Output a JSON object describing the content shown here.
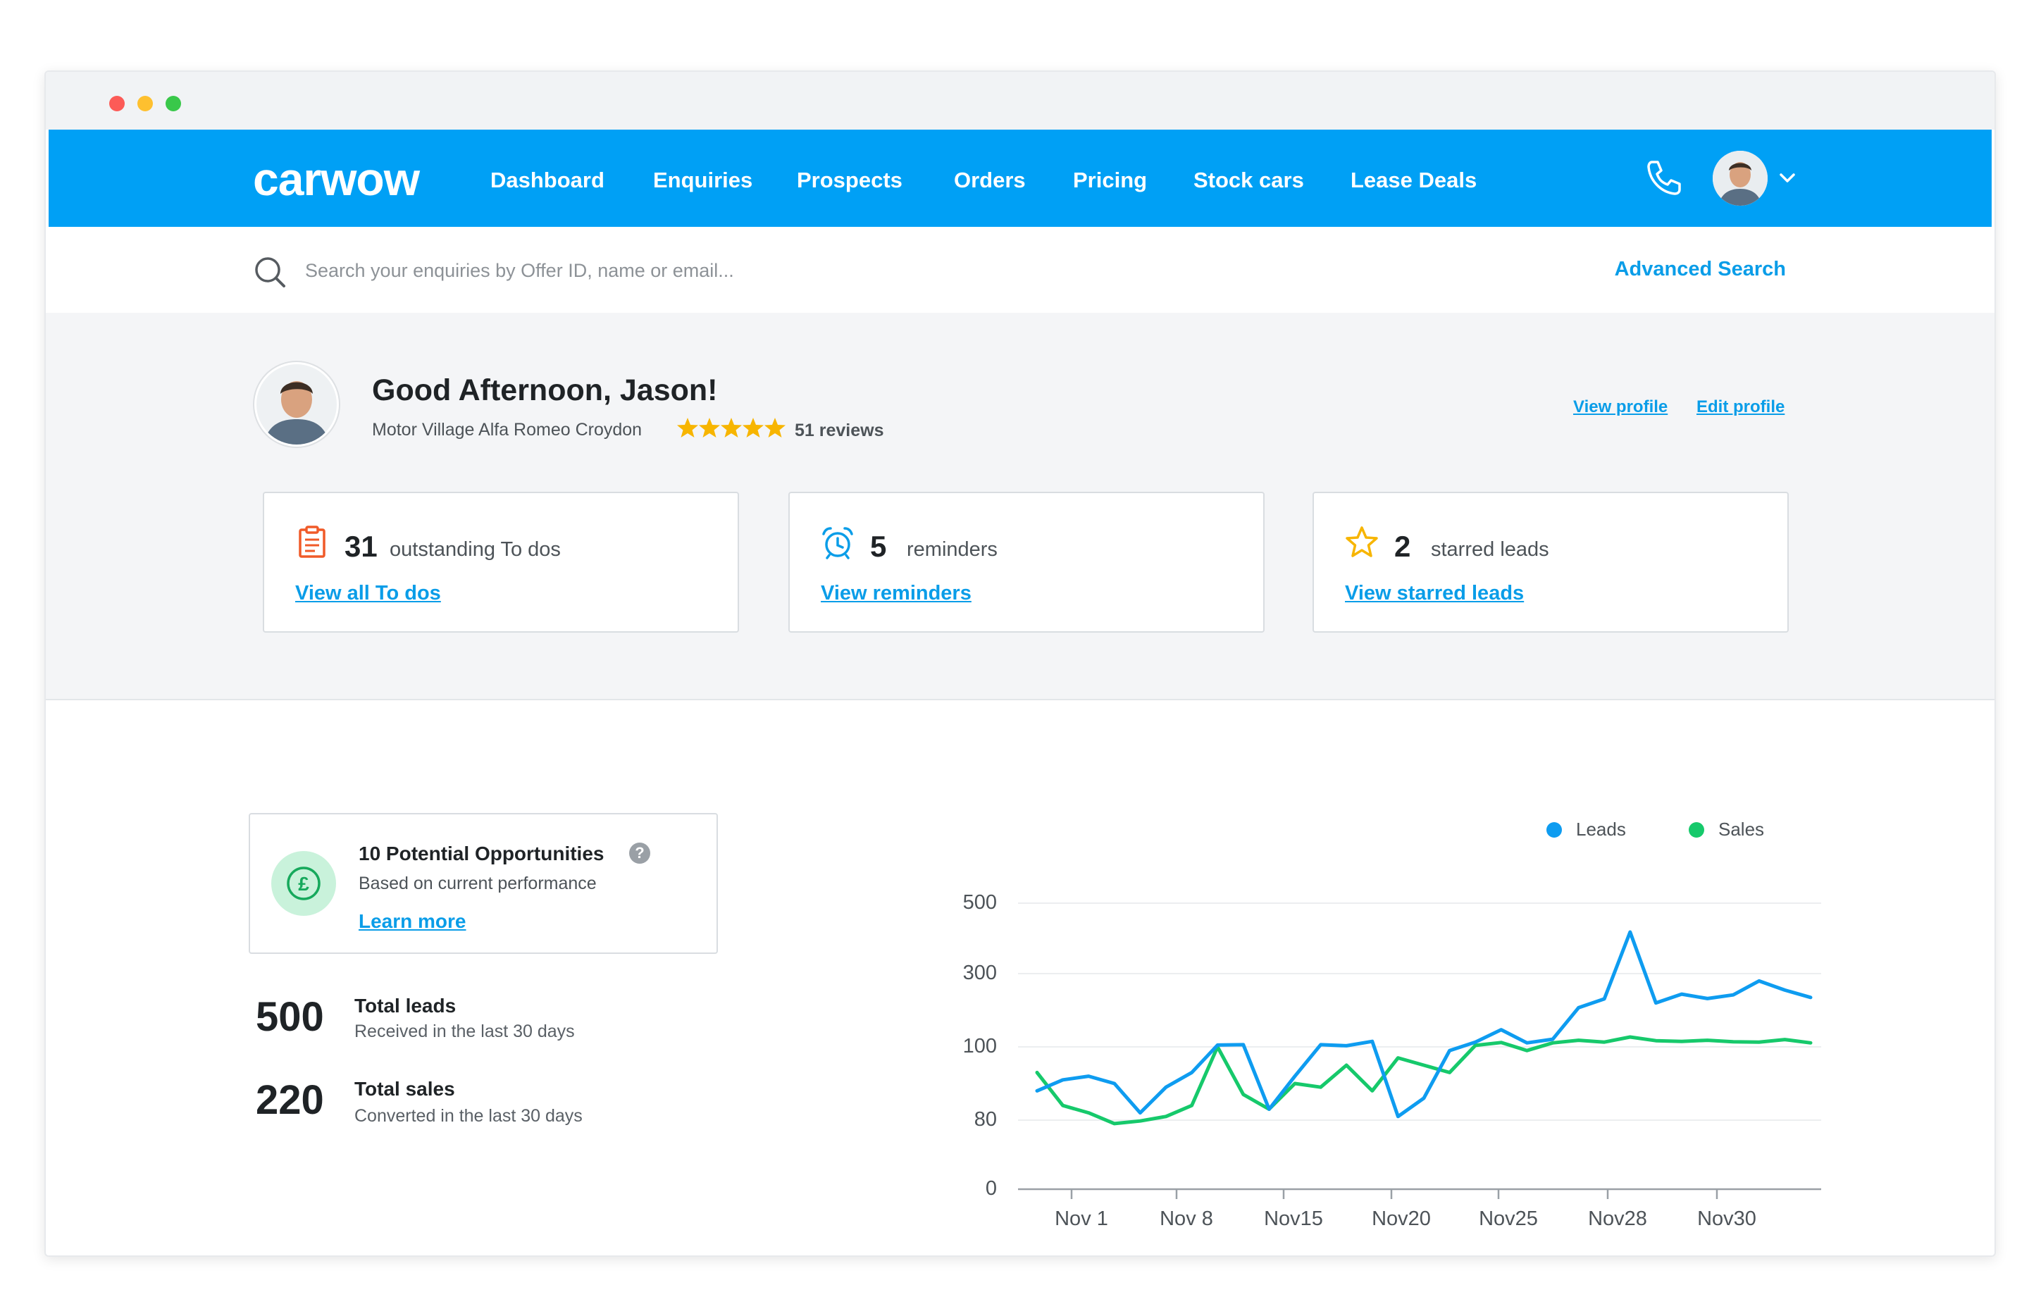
{
  "brand": {
    "logo_text": "carwow",
    "primary_color": "#00a0f5",
    "link_color": "#0a9de8",
    "sales_color": "#16c96b"
  },
  "nav": {
    "items": [
      "Dashboard",
      "Enquiries",
      "Prospects",
      "Orders",
      "Pricing",
      "Stock cars",
      "Lease Deals"
    ],
    "icons": [
      "phone-icon",
      "avatar",
      "chevron-down-icon"
    ]
  },
  "search": {
    "placeholder": "Search your enquiries by Offer ID, name or email...",
    "advanced_label": "Advanced Search"
  },
  "profile": {
    "greeting": "Good Afternoon, Jason!",
    "dealer": "Motor Village Alfa Romeo Croydon",
    "rating_stars": 5,
    "reviews": "51 reviews",
    "view_profile": "View profile",
    "edit_profile": "Edit profile"
  },
  "cards": [
    {
      "icon": "clipboard-icon",
      "count": "31",
      "label": "outstanding To dos",
      "link": "View all To dos"
    },
    {
      "icon": "alarm-clock-icon",
      "count": "5",
      "label": "reminders",
      "link": "View reminders"
    },
    {
      "icon": "star-outline-icon",
      "count": "2",
      "label": "starred leads",
      "link": "View starred leads"
    }
  ],
  "opportunities": {
    "icon": "pound-icon",
    "title": "10 Potential Opportunities",
    "help": "?",
    "subtitle": "Based on current performance",
    "link": "Learn more"
  },
  "stats": [
    {
      "value": "500",
      "title": "Total leads",
      "subtitle": "Received in the last 30 days"
    },
    {
      "value": "220",
      "title": "Total sales",
      "subtitle": "Converted in the last 30 days"
    }
  ],
  "chart_data": {
    "type": "line",
    "title": "",
    "xlabel": "",
    "ylabel": "",
    "legend_position": "top-right",
    "y_ticks": [
      "500",
      "300",
      "100",
      "80",
      "0"
    ],
    "x_ticks": [
      "Nov 1",
      "Nov 8",
      "Nov15",
      "Nov20",
      "Nov25",
      "Nov28",
      "Nov30"
    ],
    "grid": true,
    "series": [
      {
        "name": "Leads",
        "color": "#0e9cf0",
        "values": [
          88,
          91,
          92,
          90,
          82,
          89,
          93,
          105,
          106,
          83,
          92,
          106,
          103,
          115,
          81,
          86,
          99,
          113,
          147,
          111,
          121,
          207,
          231,
          418,
          220,
          244,
          232,
          242,
          280,
          255,
          235
        ]
      },
      {
        "name": "Sales",
        "color": "#16c96b",
        "values": [
          93,
          84,
          82,
          76,
          79,
          81,
          84,
          100,
          87,
          83,
          90,
          89,
          95,
          88,
          97,
          95,
          93,
          104,
          112,
          99,
          111,
          118,
          113,
          127,
          117,
          115,
          118,
          114,
          113,
          120,
          111
        ]
      }
    ]
  }
}
